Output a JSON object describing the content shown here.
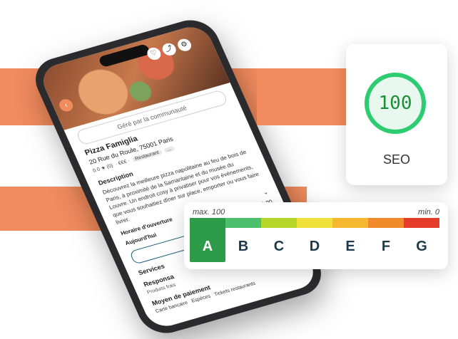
{
  "phone": {
    "community_label": "Géré par la communauté",
    "restaurant": {
      "name": "Pizza Famiglia",
      "address": "20 Rue du Roule, 75001 Paris",
      "rating": "0.0 ★ (0)",
      "price": "· €€€ ·",
      "category": "Restaurant",
      "more": "..."
    },
    "description_title": "Description",
    "description": "Découvrez la meilleure pizza napolitaine au feu de bois de Paris, à proximité de la Samaritaine et du musée du Louvre. Un endroit cosy à privatiser pour vos événements, que vous souhaitiez dîner sur place, emporter ou vous faire livrer.",
    "hours_title": "Horaire d'ouverture",
    "today_label": "Aujourd'hui",
    "today_hours": "19:00–23:00",
    "services_title": "Services",
    "responsible_title": "Responsa",
    "responsible_value": "Produits frais",
    "payment_title": "Moyen de paiement",
    "payment_methods": [
      "Carte bancaire",
      "Espèces",
      "Tickets restaurants"
    ]
  },
  "seo": {
    "score": "100",
    "label": "SEO",
    "colors": {
      "ring": "#2ecc71",
      "fill": "#e8f8ee",
      "text": "#1b8f3a"
    }
  },
  "grade": {
    "max_label": "max. 100",
    "min_label": "min. 0",
    "letters": [
      "A",
      "B",
      "C",
      "D",
      "E",
      "F",
      "G"
    ],
    "active": "A",
    "bar_colors": [
      "#2e9b49",
      "#4cc06b",
      "#b6d62c",
      "#f0e23a",
      "#f6b830",
      "#f08a2a",
      "#e53b2b"
    ]
  }
}
